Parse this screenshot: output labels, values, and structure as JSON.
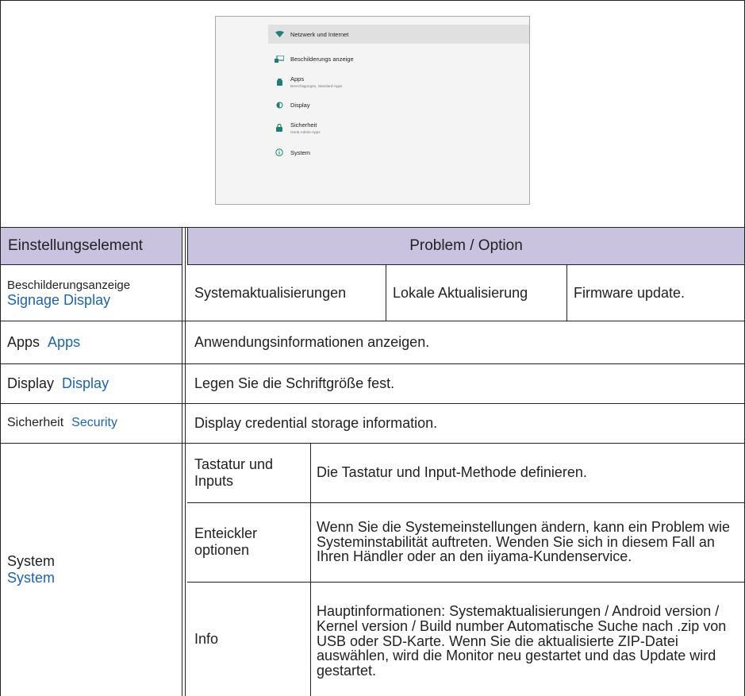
{
  "screenshot": {
    "items": [
      {
        "label": "Netzwerk und Internet",
        "sub": "",
        "icon": "wifi-icon"
      },
      {
        "label": "Beschilderungs anzeige",
        "sub": "",
        "icon": "signage-display-icon"
      },
      {
        "label": "Apps",
        "sub": "Berechtigungen, Standard-Apps",
        "icon": "android-icon"
      },
      {
        "label": "Display",
        "sub": "",
        "icon": "brightness-icon"
      },
      {
        "label": "Sicherheit",
        "sub": "Gerät Admin-Apps",
        "icon": "lock-icon"
      },
      {
        "label": "System",
        "sub": "",
        "icon": "info-icon"
      }
    ]
  },
  "table": {
    "header_left": "Einstellungselement",
    "header_right": "Problem / Option",
    "rows": {
      "signage": {
        "de": "Beschilderungsanzeige",
        "en": "Signage Display",
        "c1": "Systemaktualisierungen",
        "c2": "Lokale Aktualisierung",
        "c3": "Firmware update."
      },
      "apps": {
        "de": "Apps",
        "en": "Apps",
        "desc": "Anwendungsinformationen anzeigen."
      },
      "display": {
        "de": "Display",
        "en": "Display",
        "desc": "Legen Sie die Schriftgröße fest."
      },
      "security": {
        "de": "Sicherheit",
        "en": "Security",
        "desc": "Display credential storage information."
      },
      "system": {
        "de": "System",
        "en": "System",
        "sub": [
          {
            "name": "Tastatur und Inputs",
            "desc": "Die Tastatur und Input-Methode definieren."
          },
          {
            "name": "Enteickler optionen",
            "desc": "Wenn Sie die Systemeinstellungen ändern, kann ein Problem wie Systeminstabilität auftreten. Wenden Sie sich in diesem Fall an Ihren Händler oder an den iiyama-Kundenservice."
          },
          {
            "name": "Info",
            "desc": "Hauptinformationen: Systemaktualisierungen / Android version / Kernel version / Build number Automatische Suche nach .zip von USB oder SD-Karte. Wenn Sie die aktualisierte ZIP-Datei auswählen, wird die Monitor neu gestartet und das Update wird gestartet."
          }
        ]
      }
    }
  }
}
